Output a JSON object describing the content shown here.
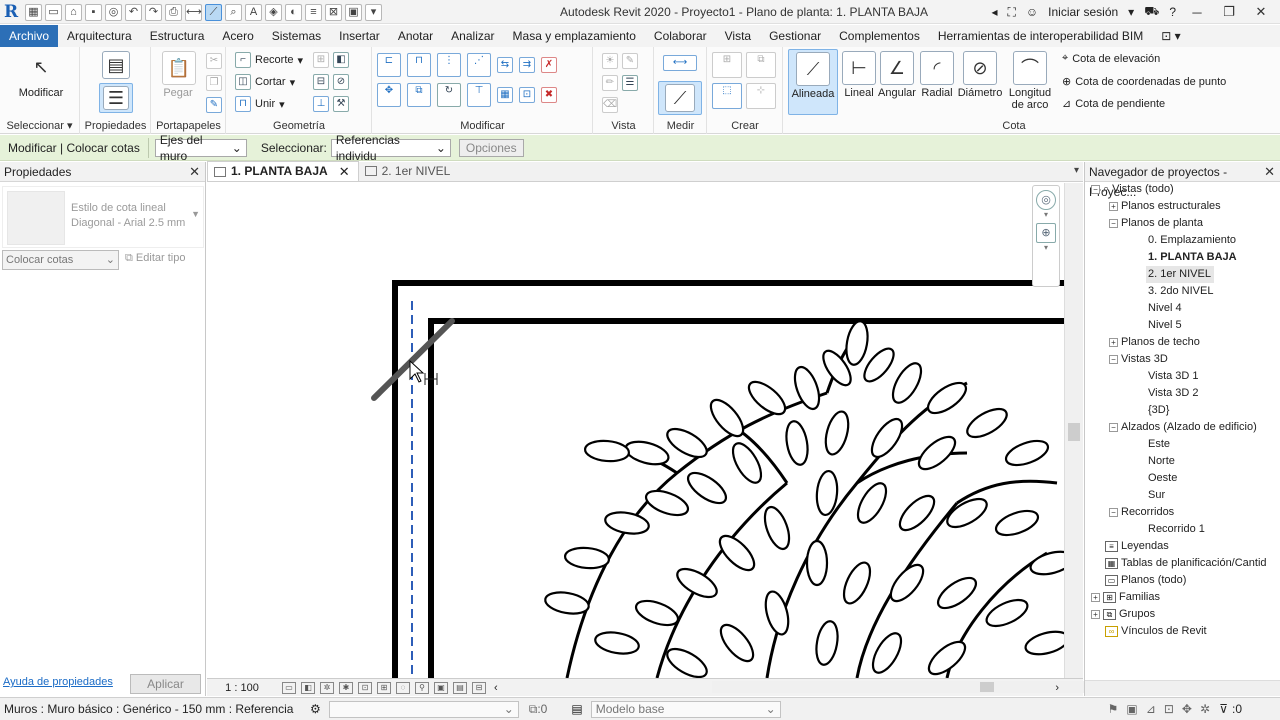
{
  "app": {
    "title": "Autodesk Revit 2020 - Proyecto1 - Plano de planta: 1. PLANTA BAJA",
    "signin": "Iniciar sesión",
    "logo": "R"
  },
  "menu": [
    "Archivo",
    "Arquitectura",
    "Estructura",
    "Acero",
    "Sistemas",
    "Insertar",
    "Anotar",
    "Analizar",
    "Masa y emplazamiento",
    "Colaborar",
    "Vista",
    "Gestionar",
    "Complementos",
    "Herramientas de interoperabilidad BIM"
  ],
  "ribbon": {
    "modificar": "Modificar",
    "seleccionar": "Seleccionar",
    "propiedades": "Propiedades",
    "pegar": "Pegar",
    "portapapeles": "Portapapeles",
    "recorte": "Recorte",
    "cortar": "Cortar",
    "unir": "Unir",
    "geometria": "Geometría",
    "modificar_panel": "Modificar",
    "vista": "Vista",
    "medir": "Medir",
    "crear": "Crear",
    "cota": "Cota",
    "cota_tools": [
      "Alineada",
      "Lineal",
      "Angular",
      "Radial",
      "Diámetro",
      "Longitud\nde arco"
    ],
    "cota_elevacion": "Cota de  elevación",
    "cota_coordenadas": "Cota de  coordenadas de punto",
    "cota_pendiente": "Cota de  pendiente"
  },
  "context": {
    "label": "Modificar | Colocar cotas",
    "ref_select": "Ejes del muro",
    "seleccionar_label": "Seleccionar:",
    "sel_value": "Referencias individu",
    "opciones": "Opciones"
  },
  "properties": {
    "title": "Propiedades",
    "type_line1": "Estilo de cota lineal",
    "type_line2": "Diagonal - Arial 2.5 mm",
    "instance": "Colocar cotas",
    "edit_type": "Editar tipo",
    "help": "Ayuda de propiedades",
    "apply": "Aplicar"
  },
  "tabs": [
    {
      "label": "1. PLANTA BAJA"
    },
    {
      "label": "2. 1er NIVEL"
    }
  ],
  "view": {
    "scale": "1 : 100"
  },
  "browser": {
    "title": "Navegador de proyectos - Proyec...",
    "items": [
      "Vistas (todo)",
      "Planos estructurales",
      "Planos de planta",
      "0. Emplazamiento",
      "1. PLANTA BAJA",
      "2. 1er NIVEL",
      "3. 2do NIVEL",
      "Nivel 4",
      "Nivel 5",
      "Planos de techo",
      "Vistas 3D",
      "Vista 3D 1",
      "Vista 3D 2",
      "{3D}",
      "Alzados (Alzado de edificio)",
      "Este",
      "Norte",
      "Oeste",
      "Sur",
      "Recorridos",
      "Recorrido 1",
      "Leyendas",
      "Tablas de planificación/Cantid",
      "Planos (todo)",
      "Familias",
      "Grupos",
      "Vínculos de Revit"
    ]
  },
  "status": {
    "text": "Muros : Muro básico : Genérico - 150 mm : Referencia",
    "sel_count": ":0",
    "model": "Modelo base",
    "filter_count": ":0"
  }
}
